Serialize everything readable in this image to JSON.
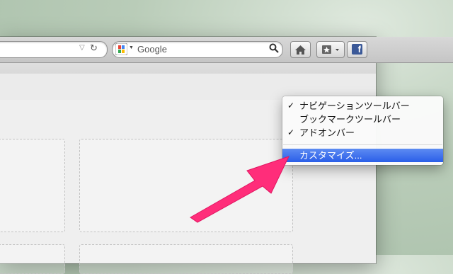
{
  "toolbar": {
    "search_placeholder": "Google",
    "search_engine_icon": "google-icon",
    "home_icon": "home-icon",
    "bookmark_icon": "bookmark-star-icon",
    "facebook_label": "f"
  },
  "context_menu": {
    "items": [
      {
        "label": "ナビゲーションツールバー",
        "checked": true
      },
      {
        "label": "ブックマークツールバー",
        "checked": false
      },
      {
        "label": "アドオンバー",
        "checked": true
      }
    ],
    "customize_label": "カスタマイズ...",
    "check_mark": "✓"
  },
  "colors": {
    "highlight": "#3366ee",
    "arrow": "#ff2d7a",
    "facebook": "#3b5998"
  }
}
